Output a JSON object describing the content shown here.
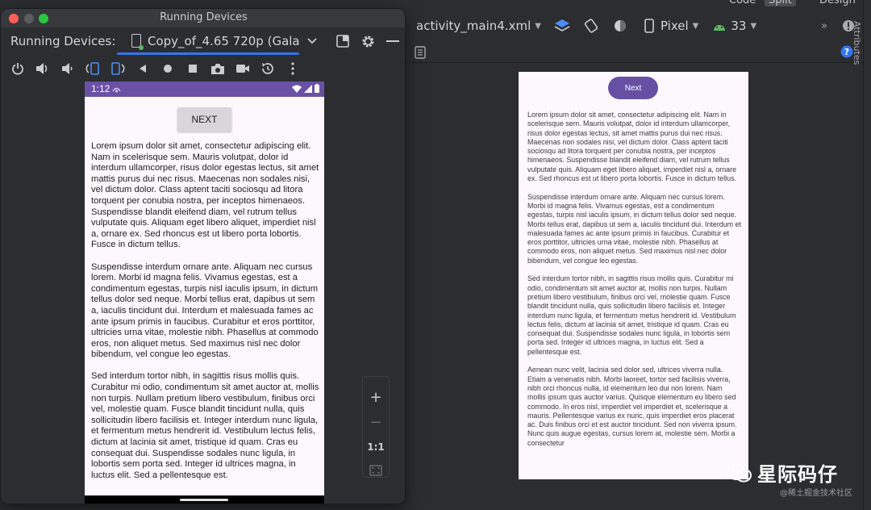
{
  "ide": {
    "top_tabs": [
      "Code",
      "Split",
      "Design"
    ],
    "active_top_tab": "Split",
    "file_tab": "activity_main4.xml",
    "device_selector": "Pixel",
    "api_selector": "33",
    "attributes_tab": "Attributes",
    "help_icon": "question-icon"
  },
  "running_devices": {
    "window_title": "Running Devices",
    "label": "Running Devices:",
    "device_tab": "Copy_of_4.65  720p (Gala",
    "controls": [
      "power-icon",
      "volume-up-icon",
      "volume-down-icon",
      "rotate-left-icon",
      "rotate-right-icon",
      "back-icon",
      "home-icon",
      "overview-icon",
      "camera-icon",
      "screenrecord-icon",
      "reset-icon",
      "more-icon"
    ]
  },
  "device": {
    "status_time": "1:12",
    "next_button": "NEXT",
    "body_text": "Lorem ipsum dolor sit amet, consectetur adipiscing elit. Nam in scelerisque sem. Mauris volutpat, dolor id interdum ullamcorper, risus dolor egestas lectus, sit amet mattis purus dui nec risus. Maecenas non sodales nisi, vel dictum dolor. Class aptent taciti sociosqu ad litora torquent per conubia nostra, per inceptos himenaeos. Suspendisse blandit eleifend diam, vel rutrum tellus vulputate quis. Aliquam eget libero aliquet, imperdiet nisl a, ornare ex. Sed rhoncus est ut libero porta lobortis. Fusce in dictum tellus.\n\n Suspendisse interdum ornare ante. Aliquam nec cursus lorem. Morbi id magna felis. Vivamus egestas, est a condimentum egestas, turpis nisl iaculis ipsum, in dictum tellus dolor sed neque. Morbi tellus erat, dapibus ut sem a, iaculis tincidunt dui. Interdum et malesuada fames ac ante ipsum primis in faucibus. Curabitur et eros porttitor, ultricies urna vitae, molestie nibh. Phasellus at commodo eros, non aliquet metus. Sed maximus nisl nec dolor bibendum, vel congue leo egestas.\n\n Sed interdum tortor nibh, in sagittis risus mollis quis. Curabitur mi odio, condimentum sit amet auctor at, mollis non turpis. Nullam pretium libero vestibulum, finibus orci vel, molestie quam. Fusce blandit tincidunt nulla, quis sollicitudin libero facilisis et. Integer interdum nunc ligula, et fermentum metus hendrerit id. Vestibulum lectus felis, dictum at lacinia sit amet, tristique id quam. Cras eu consequat dui. Suspendisse sodales nunc ligula, in lobortis sem porta sed. Integer id ultrices magna, in luctus elit. Sed a pellentesque est."
  },
  "zoom": {
    "zoom_in": "+",
    "zoom_out": "−",
    "actual_size": "1:1"
  },
  "preview": {
    "next_button": "Next",
    "body_text": "Lorem ipsum dolor sit amet, consectetur adipiscing elit. Nam in scelerisque sem. Mauris volutpat, dolor id interdum ullamcorper, risus dolor egestas lectus, sit amet mattis purus dui nec risus. Maecenas non sodales nisi, vel dictum dolor. Class aptent taciti sociosqu ad litora torquent per conubia nostra, per inceptos himenaeos. Suspendisse blandit eleifend diam, vel rutrum tellus vulputate quis. Aliquam eget libero aliquet, imperdiet nisl a, ornare ex. Sed rhoncus est ut libero porta lobortis. Fusce in dictum tellus.\n\n Suspendisse interdum ornare ante. Aliquam nec cursus lorem. Morbi id magna felis. Vivamus egestas, est a condimentum egestas, turpis nisl iaculis ipsum, in dictum tellus dolor sed neque. Morbi tellus erat, dapibus ut sem a, iaculis tincidunt dui. Interdum et malesuada fames ac ante ipsum primis in faucibus. Curabitur et eros porttitor, ultricies urna vitae, molestie nibh. Phasellus at commodo eros, non aliquet metus. Sed maximus nisl nec dolor bibendum, vel congue leo egestas.\n\n Sed interdum tortor nibh, in sagittis risus mollis quis. Curabitur mi odio, condimentum sit amet auctor at, mollis non turpis. Nullam pretium libero vestibulum, finibus orci vel, molestie quam. Fusce blandit tincidunt nulla, quis sollicitudin libero facilisis et. Integer interdum nunc ligula, et fermentum metus hendrerit id. Vestibulum lectus felis, dictum at lacinia sit amet, tristique id quam. Cras eu consequat dui. Suspendisse sodales nunc ligula, in lobortis sem porta sed. Integer id ultrices magna, in luctus elit. Sed a pellentesque est.\n\n Aenean nunc velit, lacinia sed dolor sed, ultrices viverra nulla. Etiam a venenatis nibh. Morbi laoreet, tortor sed facilisis viverra, nibh orci rhoncus nulla, id elementum leo dui non lorem. Nam mollis ipsum quis auctor varius. Quisque elementum eu libero sed commodo. In eros nisl, imperdiet vel imperdiet et, scelerisque a mauris. Pellentesque varius ex nunc, quis imperdiet eros placerat ac. Duis finibus orci et est auctor tincidunt. Sed non viverra ipsum. Nunc quis augue egestas, cursus lorem at, molestie sem. Morbi a consectetur"
  },
  "watermark": {
    "name": "星际码仔",
    "sub": "@稀土掘金技术社区"
  },
  "colors": {
    "accent": "#3574f0",
    "status_bar": "#6a51a6",
    "preview_button": "#6750a4",
    "ide_bg": "#2b2d30"
  }
}
